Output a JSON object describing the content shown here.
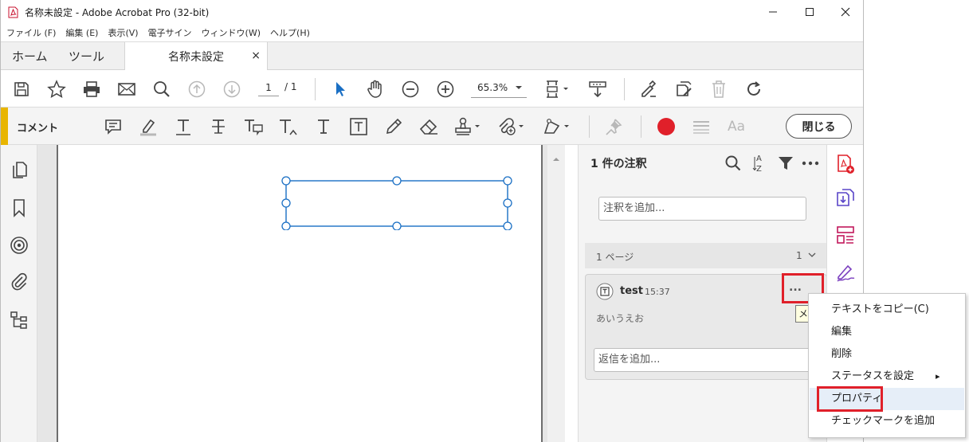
{
  "window": {
    "title": "名称未設定 - Adobe Acrobat Pro (32-bit)",
    "minimize_icon": "minimize-icon",
    "maximize_icon": "maximize-icon",
    "close_icon": "close-icon"
  },
  "menubar": {
    "items": [
      "ファイル (F)",
      "編集 (E)",
      "表示(V)",
      "電子サイン",
      "ウィンドウ(W)",
      "ヘルプ(H)"
    ]
  },
  "tabs": {
    "home": "ホーム",
    "tools": "ツール",
    "document": "名称未設定",
    "document_close": "×"
  },
  "toolbar": {
    "page_current": "1",
    "page_total": "/ 1",
    "zoom": "65.3%"
  },
  "commentbar": {
    "label": "コメント",
    "font_sample": "Aa",
    "close_label": "閉じる",
    "color_accent": "#e0202a"
  },
  "right_panel": {
    "title": "1 件の注釈",
    "add_comment_placeholder": "注釈を追加...",
    "page_group_label": "1 ページ",
    "page_group_count": "1",
    "comment": {
      "author": "test",
      "time": "15:37",
      "body": "あいうえお",
      "more": "...",
      "reply_placeholder": "返信を追加..."
    }
  },
  "tooltip": {
    "text": "メ"
  },
  "context_menu": {
    "items": [
      {
        "label": "テキストをコピー(C)"
      },
      {
        "label": "編集"
      },
      {
        "label": "削除"
      },
      {
        "label": "ステータスを設定",
        "submenu": "▸"
      },
      {
        "label": "プロパティ"
      },
      {
        "label": "チェックマークを追加"
      }
    ]
  },
  "colors": {
    "accent_yellow": "#e8b500",
    "highlight_red": "#e0202a",
    "selection_blue": "#1a6fc4",
    "menu_hover": "#e6eef8"
  }
}
